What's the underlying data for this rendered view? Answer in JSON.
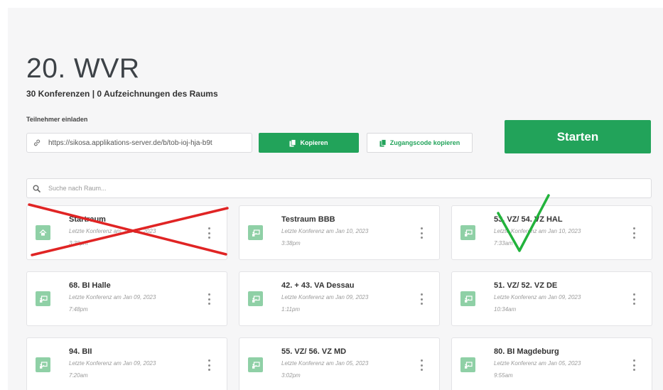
{
  "room": {
    "title": "20. WVR",
    "subtitle": "30 Konferenzen | 0 Aufzeichnungen des Raums"
  },
  "invite": {
    "label": "Teilnehmer einladen",
    "url": "https://sikosa.applikations-server.de/b/tob-ioj-hja-b9t",
    "copy_label": "Kopieren",
    "copy_code_label": "Zugangscode kopieren"
  },
  "start_label": "Starten",
  "search": {
    "placeholder": "Suche nach Raum..."
  },
  "rooms": [
    {
      "name": "Startraum",
      "date": "Letzte Konferenz am Jan 10, 2023",
      "time": "3:38pm",
      "icon": "home-icon"
    },
    {
      "name": "Testraum BBB",
      "date": "Letzte Konferenz am Jan 10, 2023",
      "time": "3:38pm",
      "icon": "presentation-icon"
    },
    {
      "name": "53. VZ/ 54. VZ HAL",
      "date": "Letzte Konferenz am Jan 10, 2023",
      "time": "7:33am",
      "icon": "presentation-icon"
    },
    {
      "name": "68. BI Halle",
      "date": "Letzte Konferenz am Jan 09, 2023",
      "time": "7:48pm",
      "icon": "presentation-icon"
    },
    {
      "name": "42. + 43. VA Dessau",
      "date": "Letzte Konferenz am Jan 09, 2023",
      "time": "1:11pm",
      "icon": "presentation-icon"
    },
    {
      "name": "51. VZ/ 52. VZ DE",
      "date": "Letzte Konferenz am Jan 09, 2023",
      "time": "10:34am",
      "icon": "presentation-icon"
    },
    {
      "name": "94. BII",
      "date": "Letzte Konferenz am Jan 09, 2023",
      "time": "7:20am",
      "icon": "presentation-icon"
    },
    {
      "name": "55. VZ/ 56. VZ MD",
      "date": "Letzte Konferenz am Jan 05, 2023",
      "time": "3:02pm",
      "icon": "presentation-icon"
    },
    {
      "name": "80. BI Magdeburg",
      "date": "Letzte Konferenz am Jan 05, 2023",
      "time": "9:55am",
      "icon": "presentation-icon"
    }
  ],
  "colors": {
    "accent": "#22a35a",
    "room_icon_bg": "#8fd0a6",
    "cross_mark": "#e02424",
    "check_mark": "#22b33c"
  }
}
